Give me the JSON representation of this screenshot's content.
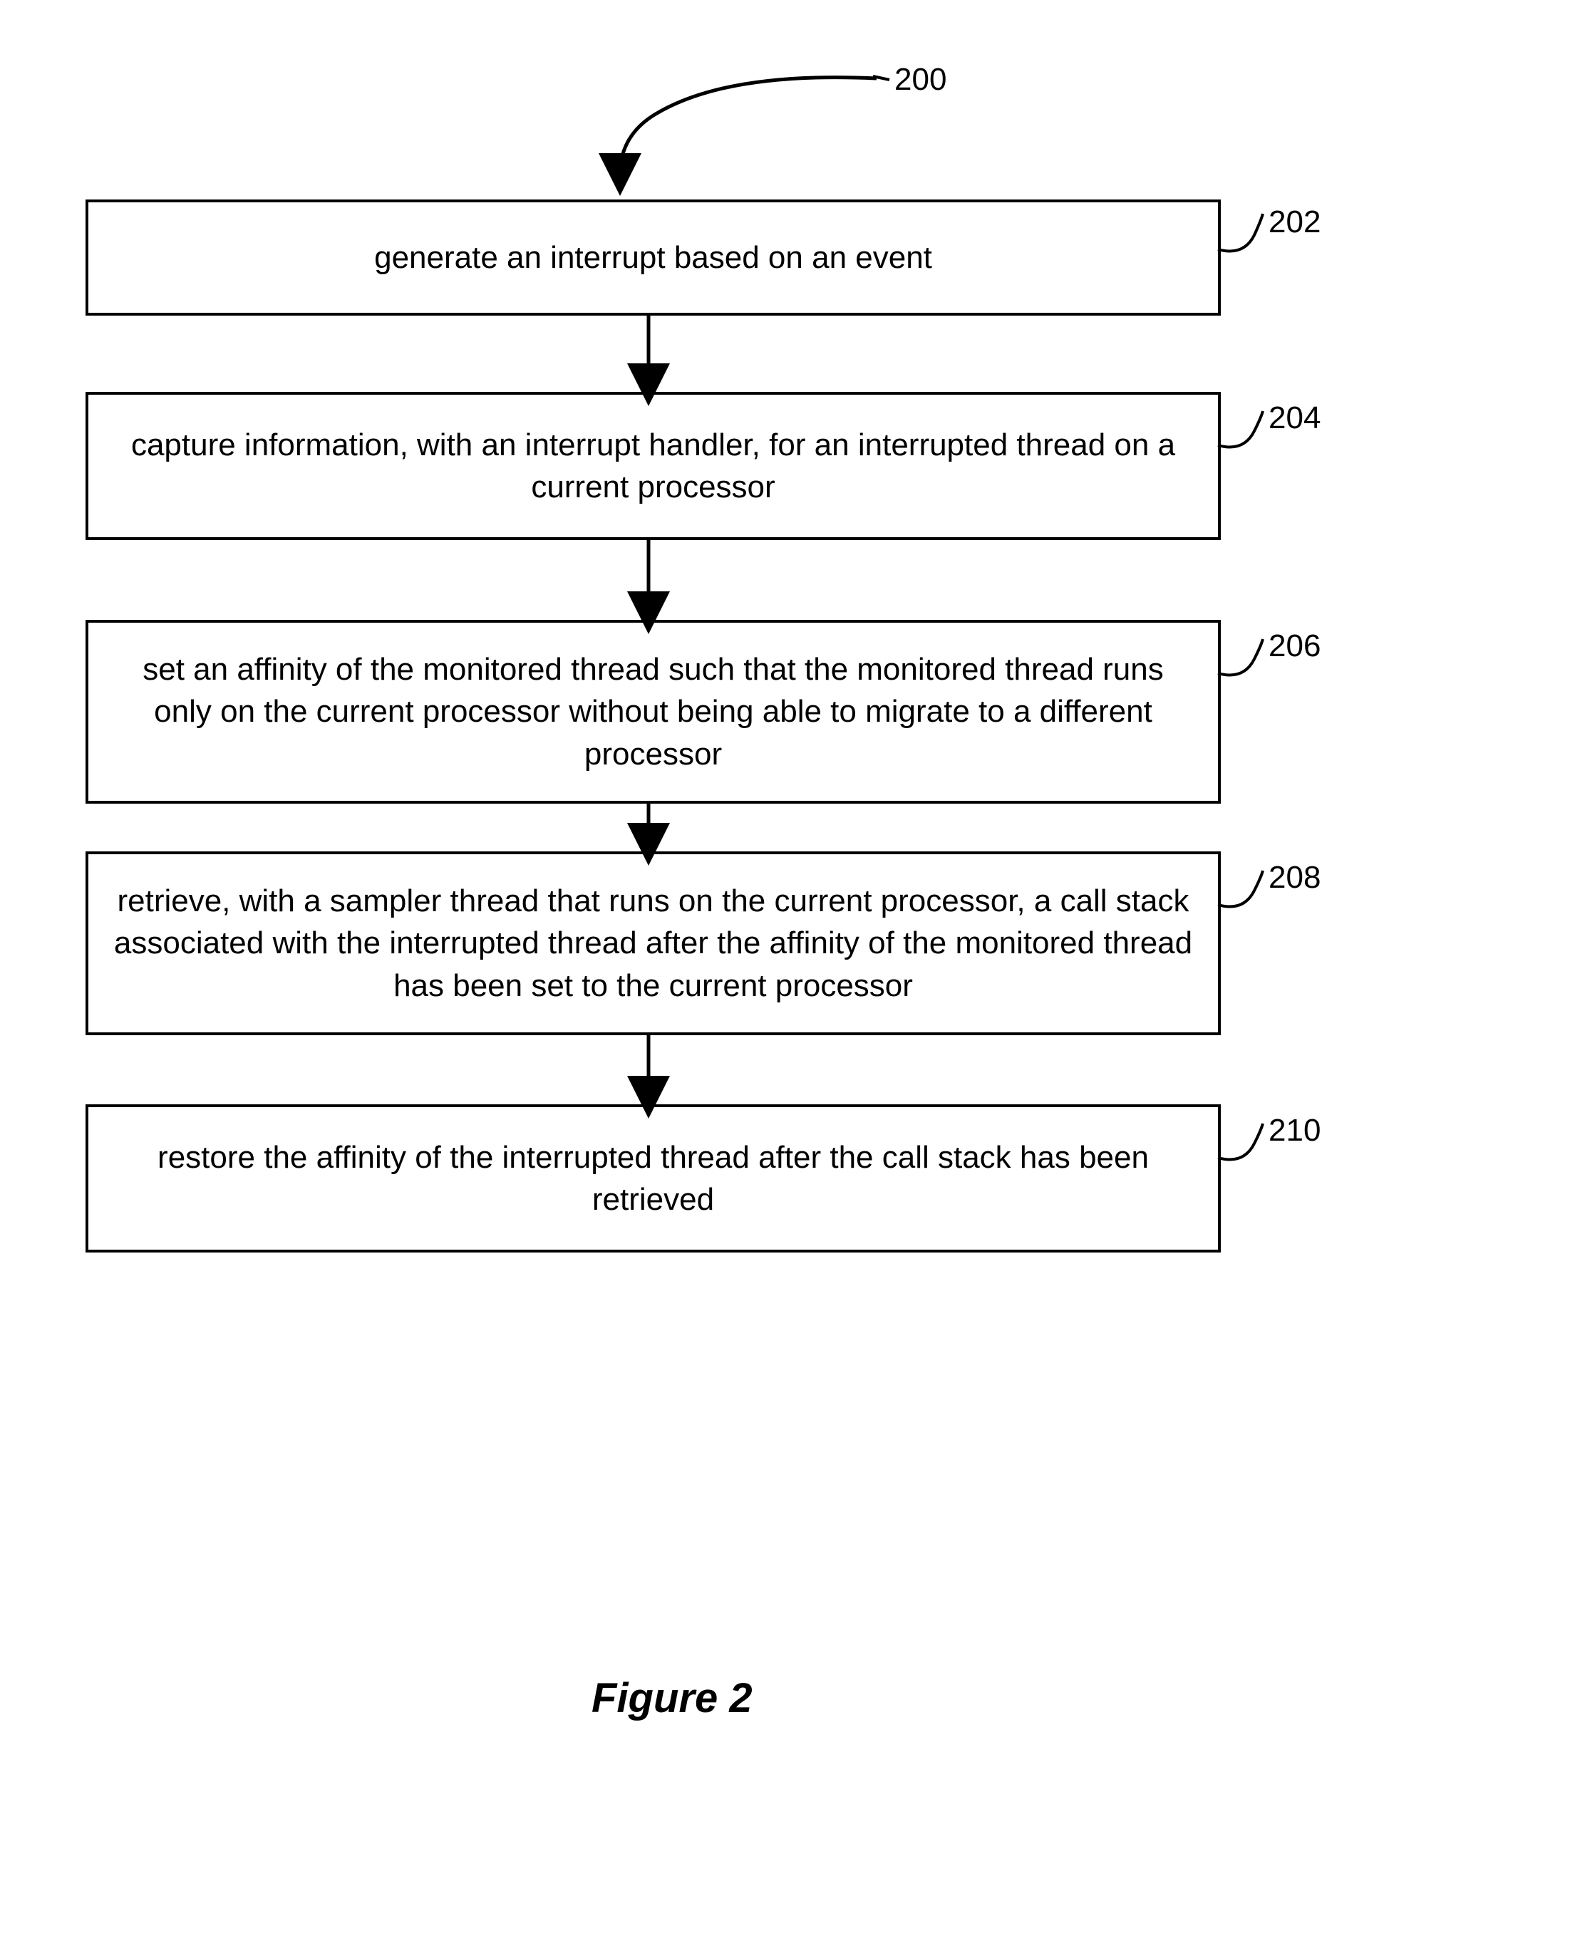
{
  "flow": {
    "title_label": "200",
    "steps": [
      {
        "id": "202",
        "text": "generate an interrupt based on an event"
      },
      {
        "id": "204",
        "text": "capture information, with an interrupt handler, for an interrupted thread on a current processor"
      },
      {
        "id": "206",
        "text": "set an affinity of the monitored thread such that the monitored thread runs only on the current processor without being able to migrate to a different processor"
      },
      {
        "id": "208",
        "text": "retrieve, with a sampler thread that runs on the current processor, a call stack associated with the interrupted thread after the affinity of the monitored thread has been set  to the current processor"
      },
      {
        "id": "210",
        "text": "restore the affinity of the interrupted thread after the call stack has been retrieved"
      }
    ]
  },
  "figure_caption": "Figure 2"
}
